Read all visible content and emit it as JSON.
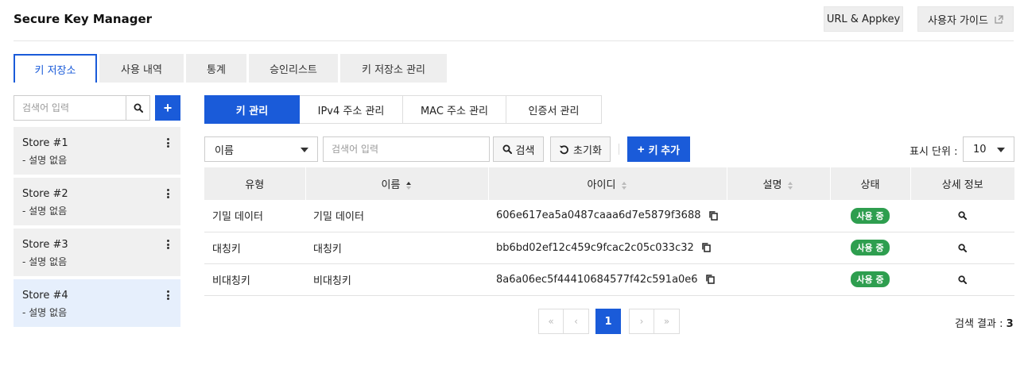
{
  "header": {
    "title": "Secure Key Manager",
    "url_appkey_label": "URL & Appkey",
    "guide_label": "사용자 가이드"
  },
  "main_tabs": [
    {
      "label": "키 저장소",
      "active": true
    },
    {
      "label": "사용 내역"
    },
    {
      "label": "통계"
    },
    {
      "label": "승인리스트"
    },
    {
      "label": "키 저장소 관리"
    }
  ],
  "store_panel": {
    "search_placeholder": "검색어 입력",
    "add_label": "+",
    "stores": [
      {
        "name": "Store #1",
        "desc": "- 설명 없음"
      },
      {
        "name": "Store #2",
        "desc": "- 설명 없음"
      },
      {
        "name": "Store #3",
        "desc": "- 설명 없음"
      },
      {
        "name": "Store #4",
        "desc": "- 설명 없음",
        "selected": true
      }
    ]
  },
  "sub_tabs": [
    {
      "label": "키 관리",
      "active": true
    },
    {
      "label": "IPv4 주소 관리"
    },
    {
      "label": "MAC 주소 관리"
    },
    {
      "label": "인증서 관리"
    }
  ],
  "toolbar": {
    "filter_value": "이름",
    "search_placeholder": "검색어 입력",
    "search_label": "검색",
    "reset_label": "초기화",
    "add_key_plus": "+",
    "add_key_label": "키 추가",
    "page_size_label": "표시 단위 :",
    "page_size_value": "10"
  },
  "table": {
    "columns": {
      "type": "유형",
      "name": "이름",
      "id": "아이디",
      "desc": "설명",
      "status": "상태",
      "detail": "상세 정보"
    },
    "rows": [
      {
        "type": "기밀 데이터",
        "name": "기밀 데이터",
        "id": "606e617ea5a0487caaa6d7e5879f3688",
        "desc": "",
        "status": "사용 중"
      },
      {
        "type": "대칭키",
        "name": "대칭키",
        "id": "bb6bd02ef12c459c9fcac2c05c033c32",
        "desc": "",
        "status": "사용 중"
      },
      {
        "type": "비대칭키",
        "name": "비대칭키",
        "id": "8a6a06ec5f44410684577f42c591a0e6",
        "desc": "",
        "status": "사용 중"
      }
    ]
  },
  "pagination": {
    "first": "«",
    "prev": "‹",
    "current": "1",
    "next": "›",
    "last": "»"
  },
  "result": {
    "label": "검색 결과 :",
    "count": "3"
  },
  "colors": {
    "primary": "#1a5bd9",
    "status_green": "#2e9e4f",
    "selected_store": "#e6effc"
  }
}
